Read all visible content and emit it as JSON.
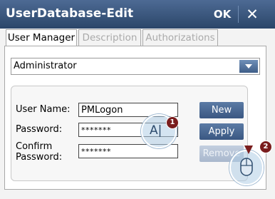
{
  "window": {
    "title": "UserDatabase-Edit",
    "ok_label": "OK",
    "close_glyph": "✕"
  },
  "tabs": [
    {
      "label": "User Manager",
      "active": true
    },
    {
      "label": "Description",
      "active": false
    },
    {
      "label": "Authorizations",
      "active": false
    }
  ],
  "user_select": {
    "value": "Administrator"
  },
  "form": {
    "user_name_label": "User Name:",
    "user_name_value": "PMLogon",
    "password_label": "Password:",
    "password_value": "*******",
    "confirm_label_line1": "Confirm",
    "confirm_label_line2": "Password:",
    "confirm_value": "*******"
  },
  "buttons": {
    "new": "New",
    "apply": "Apply",
    "remove": "Remove"
  },
  "annotations": {
    "step1": "1",
    "step2": "2",
    "keyboard_glyph": "A|"
  },
  "colors": {
    "titlebar": "#3a5680",
    "button": "#4a6a96",
    "badge": "#7a1d1d"
  }
}
